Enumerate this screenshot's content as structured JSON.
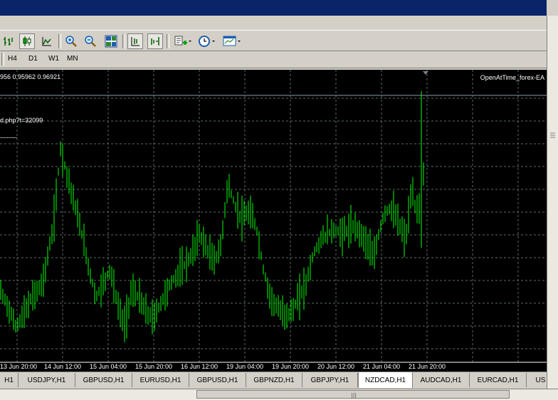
{
  "toolbar": {
    "buttons": [
      {
        "icon": "bar-chart-icon"
      },
      {
        "icon": "candlestick-icon",
        "pressed": true
      },
      {
        "icon": "line-chart-icon"
      },
      {
        "icon": "zoom-in-icon"
      },
      {
        "icon": "zoom-out-icon"
      },
      {
        "icon": "tile-windows-icon"
      },
      {
        "icon": "chart-shift-icon",
        "pressed": true
      },
      {
        "icon": "autoscroll-icon",
        "pressed": true
      },
      {
        "icon": "indicators-icon"
      },
      {
        "icon": "periods-icon"
      },
      {
        "icon": "templates-icon"
      }
    ]
  },
  "periods": [
    "H4",
    "D1",
    "W1",
    "MN"
  ],
  "chart": {
    "ohlc_text": "956 0.95962 0.96921",
    "ea_name": "OpenAtTime_forex-EA",
    "link_text": "d.php?t=32099",
    "dotted_text": "--------",
    "time_labels": [
      "13 Jun 20:00",
      "14 Jun 12:00",
      "15 Jun 04:00",
      "15 Jun 20:00",
      "16 Jun 12:00",
      "19 Jun 04:00",
      "19 Jun 20:00",
      "20 Jun 12:00",
      "21 Jun 04:00",
      "21 Jun 20:00"
    ],
    "colors": {
      "background": "#000000",
      "bars": "#00ff00",
      "grid": "#5a6a6a",
      "text": "#ffffff"
    }
  },
  "chart_data": {
    "type": "ohlc",
    "title": "",
    "xlabel": "",
    "ylabel": "",
    "x": [
      "13 Jun 20:00",
      "14 Jun 12:00",
      "15 Jun 04:00",
      "15 Jun 20:00",
      "16 Jun 12:00",
      "19 Jun 04:00",
      "19 Jun 20:00",
      "20 Jun 12:00",
      "21 Jun 04:00",
      "21 Jun 20:00"
    ],
    "series": [
      {
        "values": [
          0.3,
          0.58,
          0.42,
          0.48,
          0.62,
          0.62,
          0.48,
          0.48,
          0.72,
          0.86
        ]
      }
    ]
  },
  "tabs": [
    {
      "label": "H1"
    },
    {
      "label": "USDJPY,H1"
    },
    {
      "label": "GBPUSD,H1"
    },
    {
      "label": "EURUSD,H1"
    },
    {
      "label": "GBPUSD,H1"
    },
    {
      "label": "GBPNZD,H1"
    },
    {
      "label": "GBPJPY,H1"
    },
    {
      "label": "NZDCAD,H1",
      "active": true
    },
    {
      "label": "AUDCAD,H1"
    },
    {
      "label": "EURCAD,H1"
    },
    {
      "label": "US"
    }
  ]
}
